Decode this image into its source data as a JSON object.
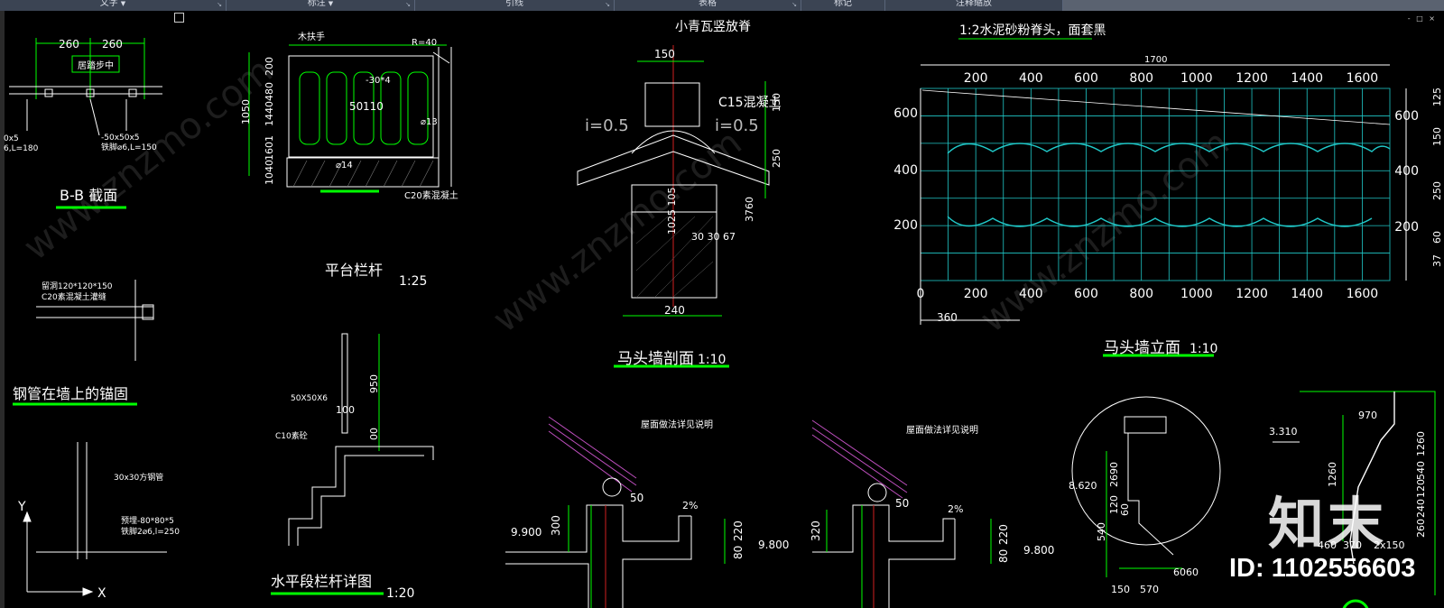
{
  "ribbon": {
    "groups": [
      {
        "label": "文字",
        "has_dropdown": true
      },
      {
        "label": "标注",
        "has_dropdown": true
      },
      {
        "label": "引线",
        "has_dropdown": false
      },
      {
        "label": "表格",
        "has_dropdown": false
      },
      {
        "label": "标记",
        "has_dropdown": false
      },
      {
        "label": "注释缩放",
        "has_dropdown": false
      }
    ],
    "dropdown_arrow": "▼",
    "launcher_icon": "↘"
  },
  "window_controls": "- □ ×",
  "drawing": {
    "bb_section": {
      "title": "B-B 截面",
      "dims": [
        "260",
        "260"
      ],
      "label_mid": "居踏步中",
      "label_a": "0x5",
      "label_b": "6,L=180",
      "label_c": "-50x50x5",
      "label_d": "铁脚⌀6,L=150"
    },
    "platform_railing": {
      "title": "平台栏杆",
      "scale": "1:25",
      "handrail": "木扶手",
      "r": "R=40",
      "bar": "-30*4",
      "dim_a": "50",
      "dim_b": "110",
      "d13": "⌀13",
      "d14": "⌀14",
      "concrete": "C20素混凝土",
      "vdims": [
        "200",
        "480",
        "1604",
        "1440",
        "1601",
        "1040",
        "1050"
      ]
    },
    "anchor": {
      "title": "钢管在墙上的锚固",
      "hole": "留洞120*120*150",
      "fill": "C20素混凝土灌缝"
    },
    "column": {
      "pipe": "30x30方钢管",
      "embed": "预埋-80*80*5",
      "foot": "铁脚2⌀6,l=250",
      "axis_y": "Y",
      "axis_x": "X"
    },
    "horizontal_railing": {
      "title": "水平段栏杆详图",
      "scale": "1:20",
      "angle": "50X50X6",
      "concrete": "C10素砼",
      "d950": "950",
      "d100": "100",
      "d00": "00"
    },
    "horse_wall_section": {
      "title": "马头墙剖面",
      "scale": "1:10",
      "ridge": "小青瓦竖放脊",
      "c15": "C15混凝土",
      "slope_l": "i=0.5",
      "slope_r": "i=0.5",
      "d150": "150",
      "d240": "240",
      "dims_small": "30 30 67",
      "vdim": "1025 105",
      "v150": "150",
      "v250": "250",
      "v3760": "3760"
    },
    "horse_wall_elevation": {
      "title": "马头墙立面",
      "scale": "1:10",
      "note": "1:2水泥砂粉脊头，面套黑",
      "d1700": "1700",
      "d360": "360",
      "top_ticks": [
        "200",
        "400",
        "600",
        "800",
        "1000",
        "1200",
        "1400",
        "1600"
      ],
      "bottom_ticks": [
        "0",
        "200",
        "400",
        "600",
        "800",
        "1000",
        "1200",
        "1400",
        "1600"
      ],
      "left_ticks": [
        "600",
        "400",
        "200"
      ],
      "right_ticks": [
        "600",
        "400",
        "200"
      ],
      "right_dims": [
        "125",
        "150",
        "250",
        "60",
        "37"
      ]
    },
    "eave_detail_1": {
      "note": "屋面做法详见说明",
      "d50": "50",
      "pct": "2%",
      "h9900": "9.900",
      "d300": "300",
      "d9800": "9.800",
      "d80": "80",
      "d220": "220"
    },
    "eave_detail_2": {
      "note": "屋面做法详见说明",
      "d50": "50",
      "pct": "2%",
      "d320": "320",
      "d9800": "9.800",
      "d80": "80",
      "d220": "220"
    },
    "gable_detail": {
      "d8620": "8.620",
      "d2690": "2690",
      "d120": "120",
      "d540": "540",
      "d60": "60",
      "d150": "150",
      "d570": "570",
      "d6060": "6060"
    },
    "gable_profile": {
      "d3310": "3.310",
      "d970": "970",
      "d1260": "1260",
      "v1260": "1260",
      "v540": "540",
      "v120": "120",
      "v240": "240",
      "v260": "260",
      "d460": "460",
      "d370": "370",
      "d2x150": "2x150",
      "d60": "60"
    }
  },
  "watermark": {
    "brand": "知末",
    "site": "www.znzmo.com",
    "id_text": "ID: 1102556603"
  },
  "colors": {
    "ribbon": "#3b4453",
    "background": "#000000",
    "green": "#00ff00",
    "white": "#ffffff",
    "yellow": "#e8e800",
    "cyan": "#20c8c8",
    "magenta": "#c050c0",
    "red": "#d02020"
  }
}
